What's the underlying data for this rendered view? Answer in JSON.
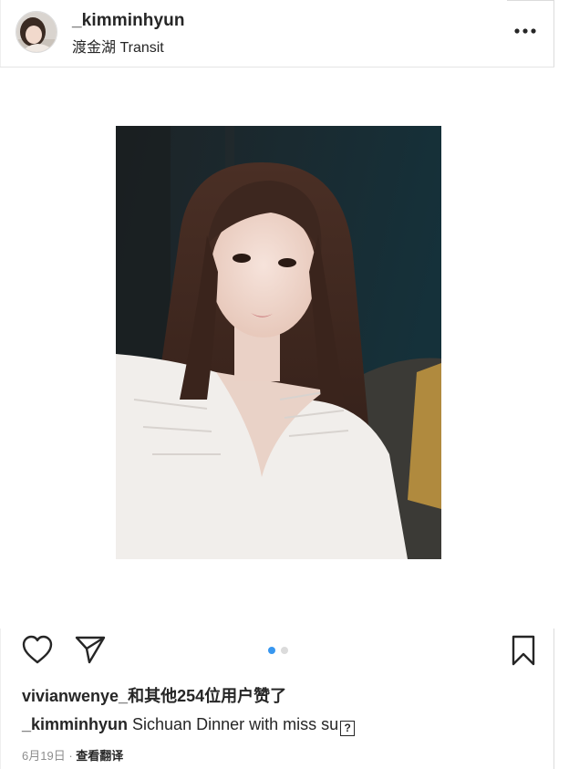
{
  "post": {
    "username": "_kimminhyun",
    "location": "渡金湖 Transit",
    "likes_text": "vivianwenye_和其他254位用户赞了",
    "caption_user": "_kimminhyun",
    "caption_text": " Sichuan Dinner with miss su",
    "caption_glyph": "?",
    "date": "6月19日",
    "separator": " · ",
    "translate_label": "查看翻译"
  },
  "icons": {
    "more": "more-options-icon",
    "like": "heart-icon",
    "share": "paper-plane-icon",
    "save": "bookmark-icon"
  },
  "carousel": {
    "current": 1,
    "total": 2
  },
  "colors": {
    "text": "#262626",
    "muted": "#8e8e8e",
    "accent": "#3897f0",
    "divider": "#e4e4e4"
  }
}
